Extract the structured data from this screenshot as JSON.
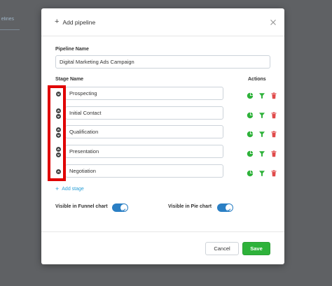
{
  "background": {
    "tab_fragment": "elines"
  },
  "modal": {
    "title": "Add pipeline",
    "pipeline_name_label": "Pipeline Name",
    "pipeline_name_value": "Digital Marketing Ads Campaign",
    "stage_name_header": "Stage Name",
    "actions_header": "Actions",
    "stages": [
      {
        "name": "Prospecting"
      },
      {
        "name": "Initial Contact"
      },
      {
        "name": "Qualification"
      },
      {
        "name": "Presentation"
      },
      {
        "name": "Negotiation"
      }
    ],
    "add_stage_label": "Add stage",
    "funnel_toggle_label": "Visible in Funnel chart",
    "funnel_toggle_on": true,
    "pie_toggle_label": "Visible in Pie chart",
    "pie_toggle_on": true,
    "cancel_label": "Cancel",
    "save_label": "Save"
  },
  "colors": {
    "action_green": "#2eb23a",
    "delete_red": "#e04a4a",
    "toggle_blue": "#2a7fc4",
    "link_blue": "#2a9fd6",
    "highlight_red": "#e00000"
  },
  "icons": {
    "stage_actions": [
      "pie-chart-icon",
      "funnel-icon",
      "trash-icon"
    ],
    "reorder": [
      "chevron-up-icon",
      "chevron-down-icon"
    ]
  }
}
